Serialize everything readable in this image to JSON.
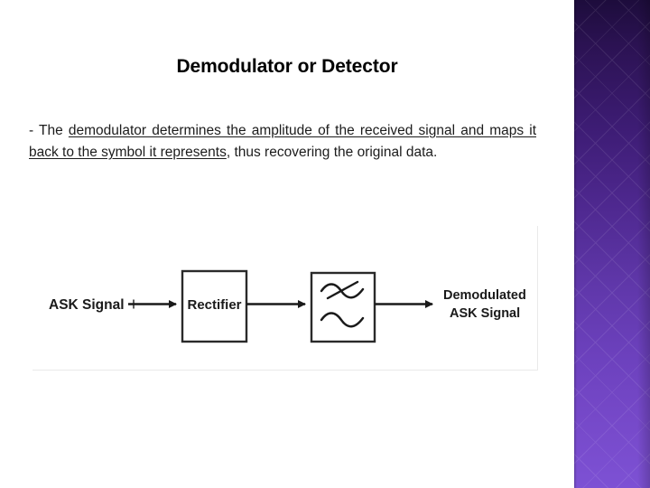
{
  "slide": {
    "title": "Demodulator or Detector",
    "body": {
      "lead": "- The ",
      "underlined": "demodulator determines the amplitude of the received signal and maps it back to the symbol it represents",
      "tail": ", thus recovering the original data."
    }
  },
  "diagram": {
    "type": "block-diagram",
    "input_label": "ASK Signal",
    "block_rectifier_label": "Rectifier",
    "block_filter_label": "",
    "block_filter_icon": "low-pass-filter-icon",
    "output_label_line1": "Demodulated",
    "output_label_line2": "ASK Signal",
    "stroke_color": "#1a1a1a",
    "box_fill": "#ffffff"
  },
  "decor": {
    "panel_name": "purple-gradient-panel",
    "gradient_top": "#241046",
    "gradient_mid": "#5b33a5",
    "gradient_bottom": "#7b50d2"
  }
}
